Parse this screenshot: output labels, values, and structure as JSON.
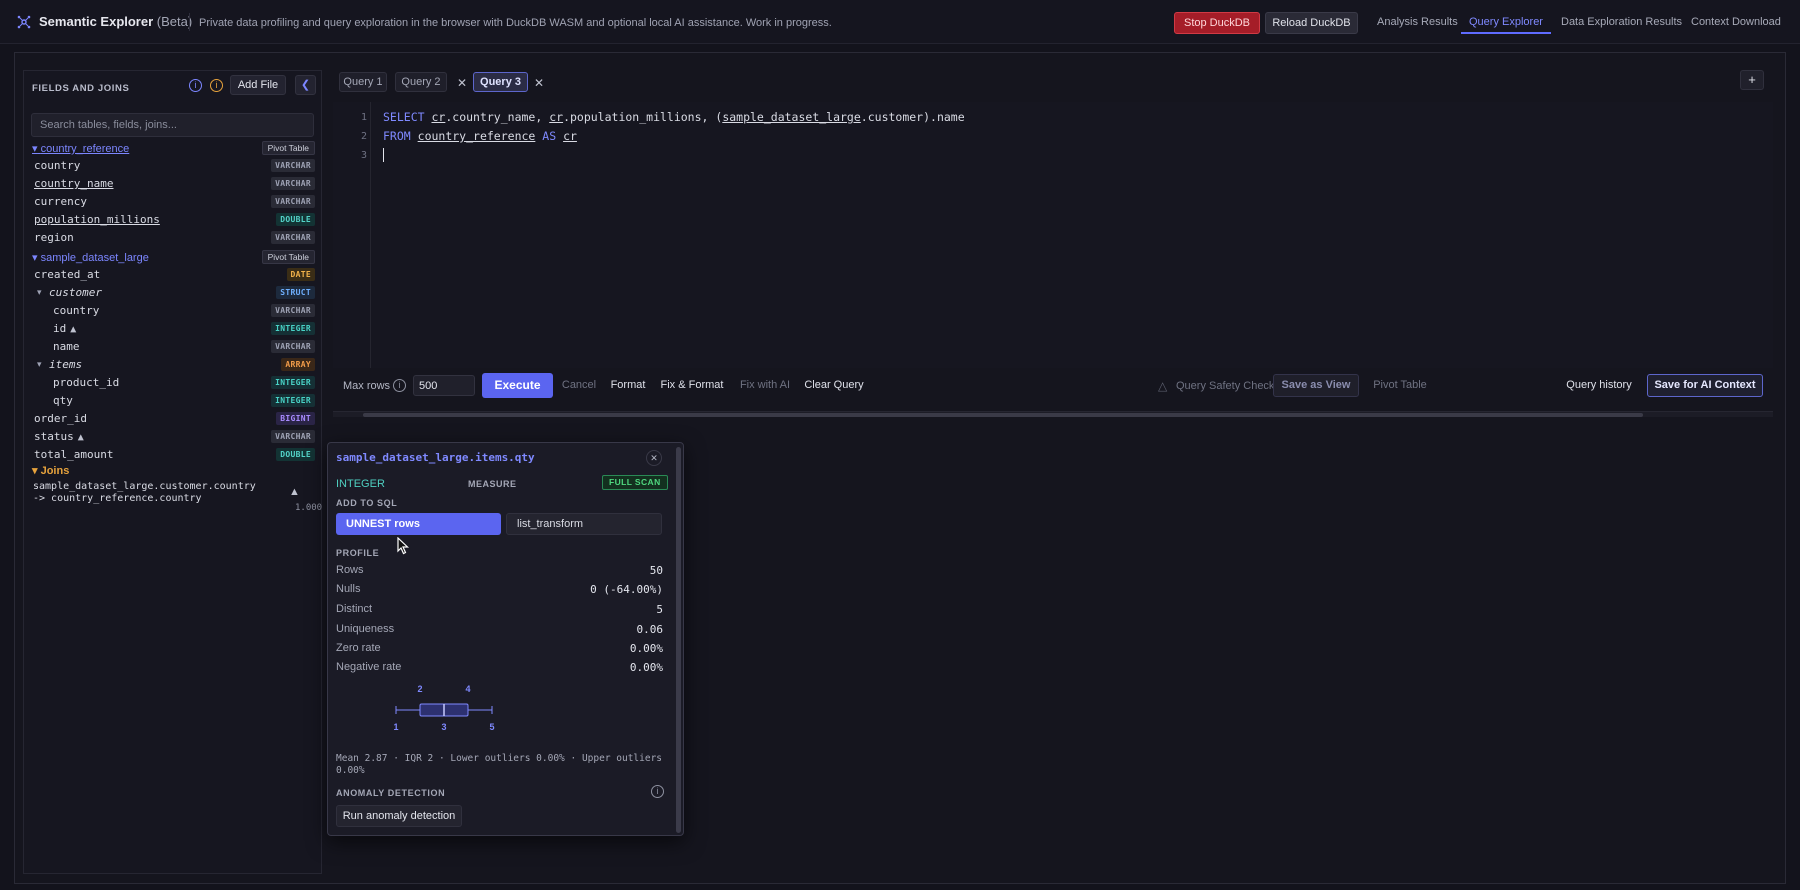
{
  "app": {
    "title": "Semantic Explorer",
    "beta": "(Beta)",
    "description": "Private data profiling and query exploration in the browser with DuckDB WASM and optional local AI assistance. Work in progress.",
    "stop_label": "Stop DuckDB",
    "reload_label": "Reload DuckDB",
    "nav": [
      "Analysis Results",
      "Query Explorer",
      "Data Exploration Results",
      "Context Download"
    ],
    "active_nav": "Query Explorer"
  },
  "sidebar": {
    "heading": "FIELDS AND JOINS",
    "add_file_label": "Add File",
    "search_placeholder": "Search tables, fields, joins...",
    "tables": [
      {
        "name": "country_reference",
        "badge": "Pivot Table",
        "fields": [
          {
            "name": "country",
            "type": "VARCHAR"
          },
          {
            "name": "country_name",
            "type": "VARCHAR"
          },
          {
            "name": "currency",
            "type": "VARCHAR"
          },
          {
            "name": "population_millions",
            "type": "DOUBLE"
          },
          {
            "name": "region",
            "type": "VARCHAR"
          }
        ]
      },
      {
        "name": "sample_dataset_large",
        "badge": "Pivot Table",
        "fields": [
          {
            "name": "created_at",
            "type": "DATE"
          },
          {
            "name": "customer",
            "type": "STRUCT"
          },
          {
            "name": "country",
            "type": "VARCHAR"
          },
          {
            "name": "id",
            "type": "INTEGER"
          },
          {
            "name": "name",
            "type": "VARCHAR"
          },
          {
            "name": "items",
            "type": "ARRAY"
          },
          {
            "name": "product_id",
            "type": "INTEGER"
          },
          {
            "name": "qty",
            "type": "INTEGER"
          },
          {
            "name": "order_id",
            "type": "BIGINT"
          },
          {
            "name": "status",
            "type": "VARCHAR"
          },
          {
            "name": "total_amount",
            "type": "DOUBLE"
          }
        ]
      }
    ],
    "joins_heading": "Joins",
    "joins": [
      {
        "text": "sample_dataset_large.customer.country -> country_reference.country",
        "score": "1.000"
      }
    ]
  },
  "editor": {
    "tabs": [
      "Query 1",
      "Query 2",
      "Query 3"
    ],
    "active_tab": "Query 3",
    "line_numbers": [
      "1",
      "2",
      "3"
    ],
    "line1": {
      "kw1": "SELECT",
      "a1": "cr",
      "t1": ".country_name, ",
      "a2": "cr",
      "t2": ".population_millions, (",
      "tbl": "sample_dataset_large",
      "t3": ".customer).name"
    },
    "line2": {
      "kw1": "FROM",
      "tbl": "country_reference",
      "kw2": "AS",
      "alias": "cr"
    }
  },
  "toolbar": {
    "max_rows_label": "Max rows",
    "max_rows_value": "500",
    "execute_label": "Execute",
    "cancel_label": "Cancel",
    "format_label": "Format",
    "fix_format_label": "Fix & Format",
    "fix_ai_label": "Fix with AI",
    "clear_label": "Clear Query",
    "safety_label": "Query Safety Check",
    "save_view_label": "Save as View",
    "pivot_label": "Pivot Table",
    "history_label": "Query history",
    "save_ai_label": "Save for AI Context"
  },
  "popover": {
    "title": "sample_dataset_large.items.qty",
    "type": "INTEGER",
    "role": "MEASURE",
    "scan_badge": "FULL SCAN",
    "add_to_sql_heading": "ADD TO SQL",
    "unnest_label": "UNNEST rows",
    "list_transform_label": "list_transform",
    "profile_heading": "PROFILE",
    "profile": [
      {
        "label": "Rows",
        "value": "50"
      },
      {
        "label": "Nulls",
        "value": "0 (-64.00%)"
      },
      {
        "label": "Distinct",
        "value": "5"
      },
      {
        "label": "Uniqueness",
        "value": "0.06"
      },
      {
        "label": "Zero rate",
        "value": "0.00%"
      },
      {
        "label": "Negative rate",
        "value": "0.00%"
      }
    ],
    "boxplot": {
      "min": 1,
      "q1": 2,
      "median": 3,
      "q3": 4,
      "max": 5,
      "labels": {
        "min": "1",
        "q1": "2",
        "median": "3",
        "q3": "4",
        "max": "5"
      }
    },
    "summary": "Mean 2.87 · IQR 2 · Lower outliers 0.00% · Upper outliers 0.00%",
    "anomaly_heading": "ANOMALY DETECTION",
    "anomaly_button": "Run anomaly detection"
  },
  "colors": {
    "accent": "#5b65f0",
    "link": "#7f89ff",
    "danger": "#a51d28",
    "success": "#4fd77f"
  }
}
